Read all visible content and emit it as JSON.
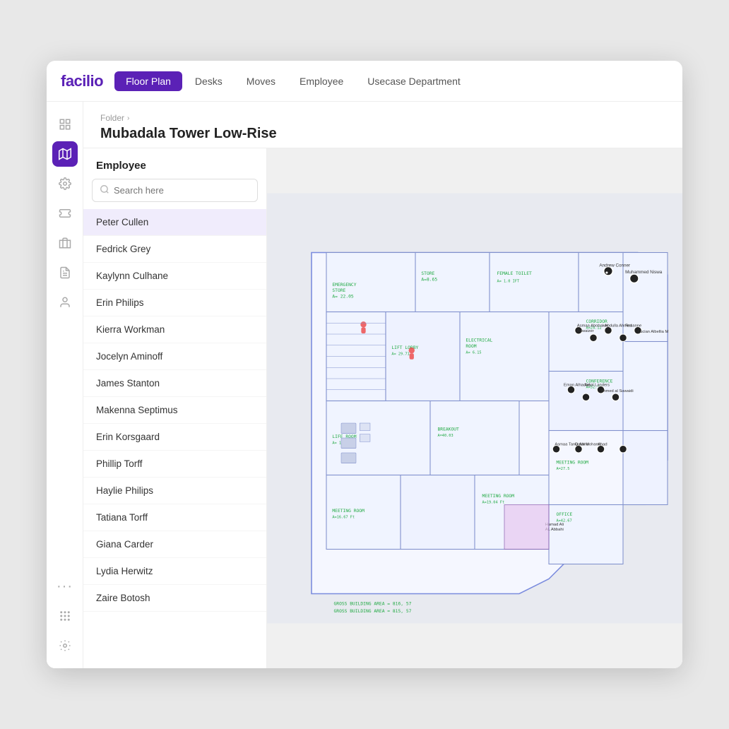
{
  "app": {
    "logo": "facilio"
  },
  "nav": {
    "tabs": [
      {
        "id": "floor-plan",
        "label": "Floor Plan",
        "active": true
      },
      {
        "id": "desks",
        "label": "Desks",
        "active": false
      },
      {
        "id": "moves",
        "label": "Moves",
        "active": false
      },
      {
        "id": "employee",
        "label": "Employee",
        "active": false
      },
      {
        "id": "usecase-department",
        "label": "Usecase Department",
        "active": false
      }
    ]
  },
  "sidebar": {
    "icons": [
      {
        "id": "grid-icon",
        "symbol": "⊞",
        "active": false
      },
      {
        "id": "map-icon",
        "symbol": "🗺",
        "active": true
      },
      {
        "id": "settings-cog-icon",
        "symbol": "⚙",
        "active": false
      },
      {
        "id": "ticket-icon",
        "symbol": "🎫",
        "active": false
      },
      {
        "id": "building-icon",
        "symbol": "🏢",
        "active": false
      },
      {
        "id": "list-icon",
        "symbol": "☰",
        "active": false
      },
      {
        "id": "person-icon",
        "symbol": "👤",
        "active": false
      },
      {
        "id": "gear-icon",
        "symbol": "⚙",
        "active": false
      }
    ]
  },
  "breadcrumb": {
    "folder": "Folder",
    "chevron": "›"
  },
  "page_title": "Mubadala Tower Low-Rise",
  "employee_panel": {
    "title": "Employee",
    "search_placeholder": "Search here",
    "employees": [
      {
        "id": 1,
        "name": "Peter Cullen",
        "selected": true
      },
      {
        "id": 2,
        "name": "Fedrick Grey",
        "selected": false
      },
      {
        "id": 3,
        "name": "Kaylynn Culhane",
        "selected": false
      },
      {
        "id": 4,
        "name": "Erin Philips",
        "selected": false
      },
      {
        "id": 5,
        "name": "Kierra Workman",
        "selected": false
      },
      {
        "id": 6,
        "name": "Jocelyn Aminoff",
        "selected": false
      },
      {
        "id": 7,
        "name": "James Stanton",
        "selected": false
      },
      {
        "id": 8,
        "name": "Makenna Septimus",
        "selected": false
      },
      {
        "id": 9,
        "name": "Erin Korsgaard",
        "selected": false
      },
      {
        "id": 10,
        "name": "Phillip Torff",
        "selected": false
      },
      {
        "id": 11,
        "name": "Haylie Philips",
        "selected": false
      },
      {
        "id": 12,
        "name": "Tatiana Torff",
        "selected": false
      },
      {
        "id": 13,
        "name": "Giana Carder",
        "selected": false
      },
      {
        "id": 14,
        "name": "Lydia Herwitz",
        "selected": false
      },
      {
        "id": 15,
        "name": "Zaire Botosh",
        "selected": false
      }
    ]
  }
}
